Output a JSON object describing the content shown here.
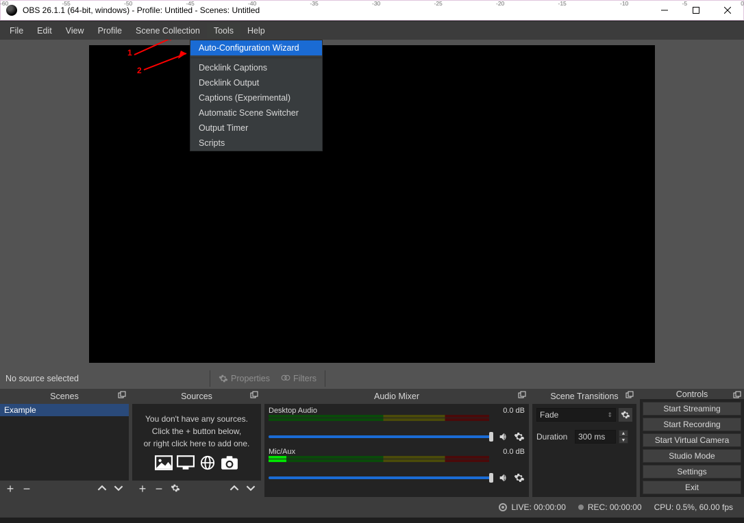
{
  "titlebar": {
    "title": "OBS 26.1.1 (64-bit, windows) - Profile: Untitled - Scenes: Untitled"
  },
  "menubar": {
    "items": [
      "File",
      "Edit",
      "View",
      "Profile",
      "Scene Collection",
      "Tools",
      "Help"
    ],
    "open_index": 5
  },
  "tools_menu": {
    "highlighted": "Auto-Configuration Wizard",
    "items": [
      "Decklink Captions",
      "Decklink Output",
      "Captions (Experimental)",
      "Automatic Scene Switcher",
      "Output Timer",
      "Scripts"
    ]
  },
  "annotations": {
    "label1": "1",
    "label2": "2"
  },
  "midbar": {
    "status": "No source selected",
    "properties": "Properties",
    "filters": "Filters"
  },
  "scenes": {
    "title": "Scenes",
    "items": [
      "Example"
    ]
  },
  "sources": {
    "title": "Sources",
    "empty1": "You don't have any sources.",
    "empty2": "Click the + button below,",
    "empty3": "or right click here to add one."
  },
  "mixer": {
    "title": "Audio Mixer",
    "ch1_name": "Desktop Audio",
    "ch1_level": "0.0 dB",
    "ch2_name": "Mic/Aux",
    "ch2_level": "0.0 dB",
    "ticks": [
      "-60",
      "-55",
      "-50",
      "-45",
      "-40",
      "-35",
      "-30",
      "-25",
      "-20",
      "-15",
      "-10",
      "-5",
      "0"
    ]
  },
  "transitions": {
    "title": "Scene Transitions",
    "selected": "Fade",
    "duration_label": "Duration",
    "duration_value": "300 ms"
  },
  "controls": {
    "title": "Controls",
    "buttons": [
      "Start Streaming",
      "Start Recording",
      "Start Virtual Camera",
      "Studio Mode",
      "Settings",
      "Exit"
    ]
  },
  "statusbar": {
    "live": "LIVE: 00:00:00",
    "rec": "REC: 00:00:00",
    "cpu": "CPU: 0.5%, 60.00 fps"
  }
}
